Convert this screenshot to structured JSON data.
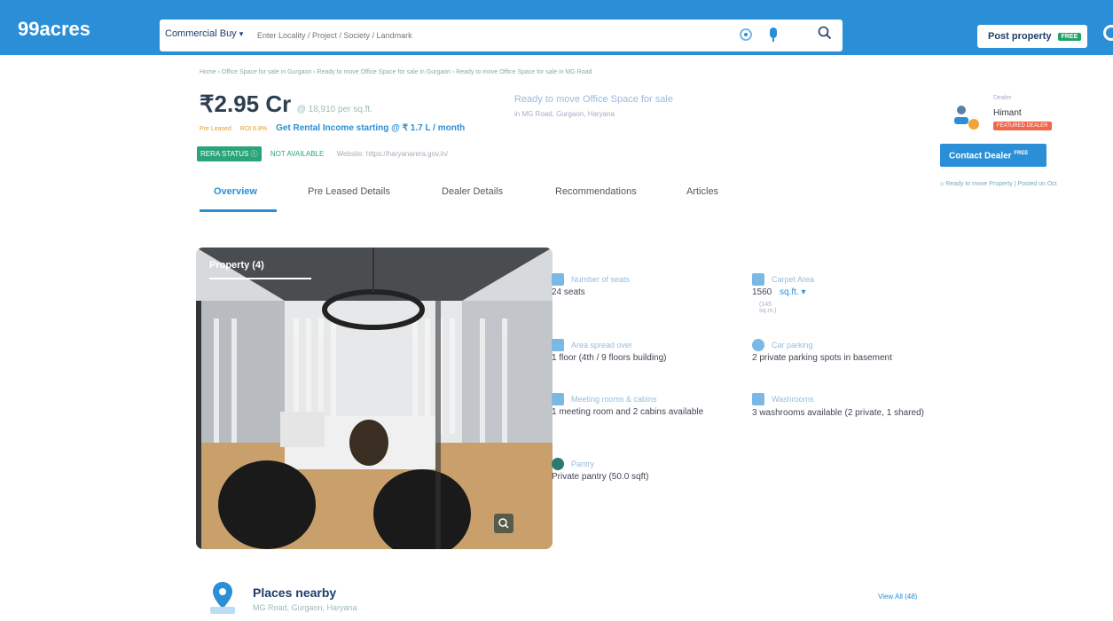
{
  "header": {
    "logo": "99acres",
    "search_category": "Commercial Buy",
    "search_placeholder": "Enter Locality / Project / Society / Landmark",
    "post_property_label": "Post property",
    "post_property_badge": "FREE"
  },
  "breadcrumb": "Home › Office Space for sale in Gurgaon › Ready to move Office Space for sale in Gurgaon › Ready to move Office Space for sale in MG Road",
  "listing": {
    "price": "₹2.95 Cr",
    "price_per_sqft": "@ 18,910 per sq.ft.",
    "tag_preleased": "Pre Leased",
    "tag_roi": "ROI 6.8%",
    "rental_text": "Get Rental Income starting @ ₹ 1.7 L / month",
    "rera_status_label": "RERA STATUS",
    "rera_status_value": "NOT AVAILABLE",
    "rera_website": "Website: https://haryanarera.gov.in/",
    "title": "Ready to move Office Space for sale",
    "location": "in MG Road, Gurgaon, Haryana"
  },
  "tabs": [
    {
      "label": "Overview"
    },
    {
      "label": "Pre Leased Details"
    },
    {
      "label": "Dealer Details"
    },
    {
      "label": "Recommendations"
    },
    {
      "label": "Articles"
    }
  ],
  "dealer": {
    "role": "Dealer",
    "name": "Himant",
    "badge": "FEATURED DEALER",
    "contact_label": "Contact Dealer",
    "contact_badge": "FREE",
    "note": "Ready to move Property  |  Posted on Oct"
  },
  "photo": {
    "label": "Property (4)"
  },
  "features": [
    {
      "label": "Number of seats",
      "value": "24 seats",
      "icon": "seat-icon"
    },
    {
      "label": "Carpet Area",
      "value": "1560",
      "unit": "sq.ft.",
      "sub": "(145 sq.m.)",
      "icon": "area-icon"
    },
    {
      "label": "Area spread over",
      "value": "1 floor (4th / 9 floors building)",
      "icon": "building-icon"
    },
    {
      "label": "Car parking",
      "value": "2 private parking spots in basement",
      "icon": "car-icon"
    },
    {
      "label": "Meeting rooms & cabins",
      "value": "1 meeting room and 2 cabins available",
      "icon": "meeting-icon"
    },
    {
      "label": "Washrooms",
      "value": "3 washrooms available (2 private, 1 shared)",
      "icon": "washroom-icon"
    },
    {
      "label": "Pantry",
      "value": "Private pantry (50.0 sqft)",
      "icon": "pantry-icon"
    }
  ],
  "places": {
    "title": "Places nearby",
    "location": "MG Road, Gurgaon, Haryana",
    "view_all": "View All (48)"
  },
  "colors": {
    "brand_blue": "#2a8fd6",
    "rera_green": "#2aa57a",
    "featured_red": "#f2664a",
    "preleased_orange": "#e59a2c"
  }
}
